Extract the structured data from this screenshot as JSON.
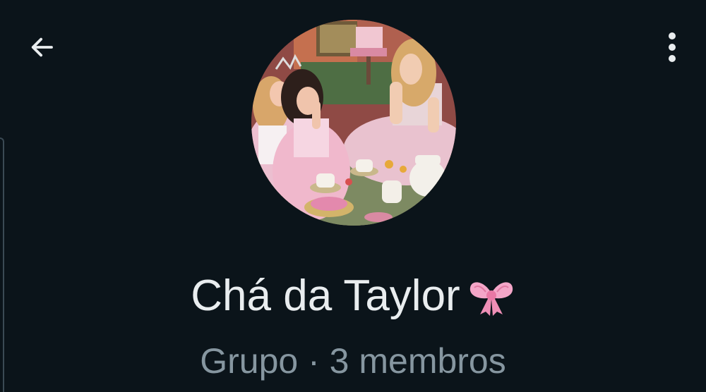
{
  "header": {
    "back_icon": "arrow-left-icon",
    "menu_icon": "more-vertical-icon"
  },
  "profile": {
    "name": "Chá da Taylor",
    "emoji": "🎀",
    "emoji_icon": "pink-ribbon-bow-icon",
    "type": "Grupo",
    "separator": " · ",
    "members": "3 membros"
  },
  "colors": {
    "background": "#0b141a",
    "primary_text": "#e9edef",
    "secondary_text": "#8696a0",
    "bow": "#f4a6c8"
  }
}
